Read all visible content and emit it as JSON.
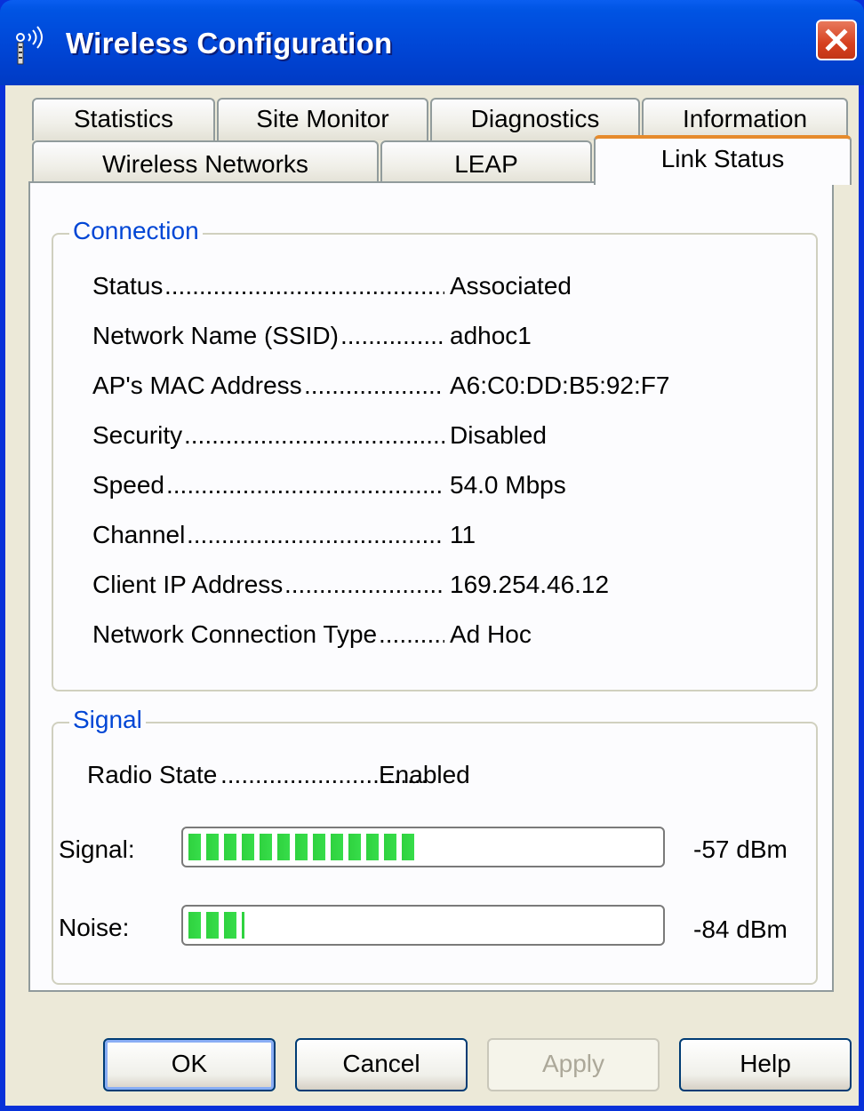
{
  "window": {
    "title": "Wireless Configuration",
    "title_icon": "wireless-antenna-icon",
    "close_icon": "close-icon"
  },
  "tabs_row1": [
    {
      "label": "Statistics"
    },
    {
      "label": "Site Monitor"
    },
    {
      "label": "Diagnostics"
    },
    {
      "label": "Information"
    }
  ],
  "tabs_row2": [
    {
      "label": "Wireless Networks"
    },
    {
      "label": "LEAP"
    },
    {
      "label": "Link Status",
      "active": true
    }
  ],
  "connection": {
    "group_label": "Connection",
    "rows": [
      {
        "label": "Status",
        "value": "Associated"
      },
      {
        "label": "Network Name (SSID)",
        "value": "adhoc1"
      },
      {
        "label": "AP's MAC Address",
        "value": "A6:C0:DD:B5:92:F7"
      },
      {
        "label": "Security",
        "value": "Disabled"
      },
      {
        "label": "Speed",
        "value": "54.0 Mbps"
      },
      {
        "label": "Channel",
        "value": "11"
      },
      {
        "label": "Client IP Address",
        "value": "169.254.46.12"
      },
      {
        "label": "Network Connection Type",
        "value": "Ad Hoc"
      }
    ]
  },
  "signal": {
    "group_label": "Signal",
    "radio_state_label": "Radio State",
    "radio_state_value": "Enabled",
    "meters": [
      {
        "label": "Signal:",
        "value": "-57 dBm",
        "level_fraction": 0.49
      },
      {
        "label": "Noise:",
        "value": "-84 dBm",
        "level_fraction": 0.12
      }
    ],
    "meter_color": "#2fd23f"
  },
  "buttons": {
    "ok": "OK",
    "cancel": "Cancel",
    "apply": "Apply",
    "help": "Help"
  },
  "colors": {
    "titlebar": "#0054e3",
    "group_label": "#0046d5",
    "active_tab_accent": "#e68b2c",
    "dialog_bg": "#ece9d8"
  }
}
